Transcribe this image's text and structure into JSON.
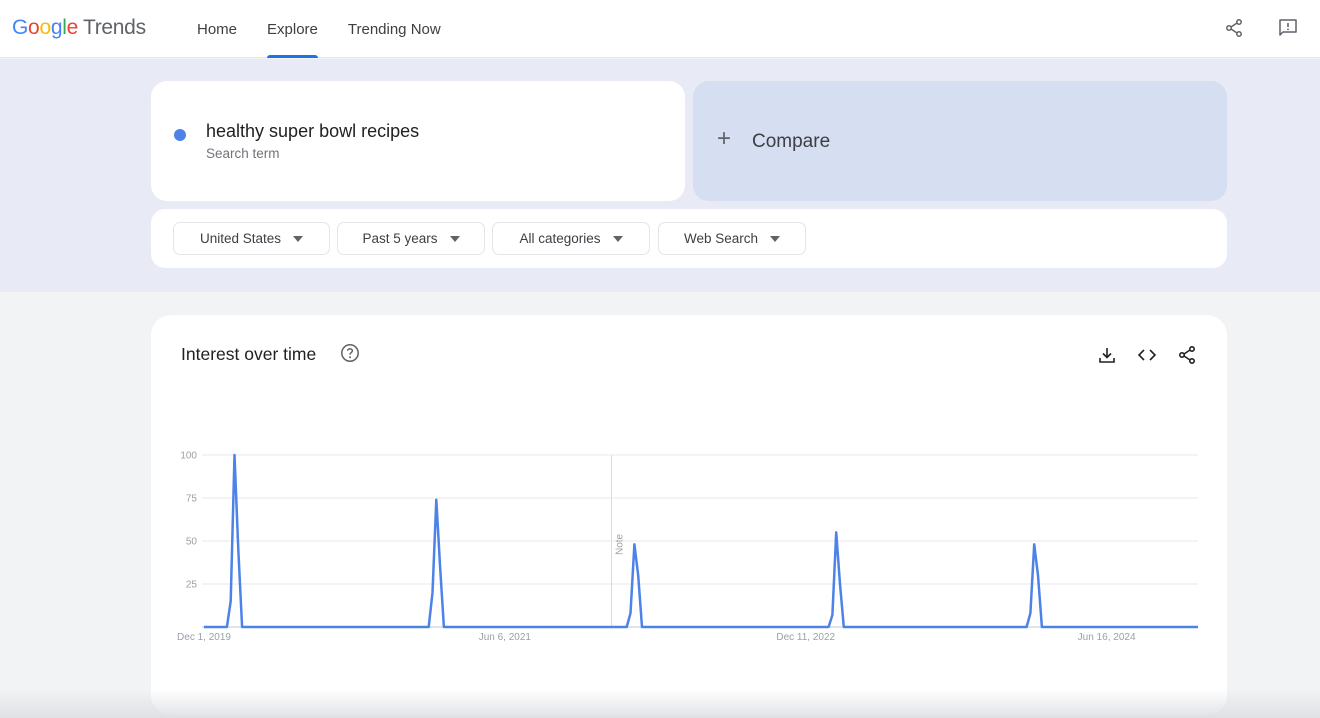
{
  "header": {
    "logo": {
      "letters": [
        "G",
        "o",
        "o",
        "g",
        "l",
        "e"
      ],
      "product": "Trends"
    },
    "nav": [
      {
        "label": "Home",
        "active": false
      },
      {
        "label": "Explore",
        "active": true
      },
      {
        "label": "Trending Now",
        "active": false
      }
    ],
    "icons": [
      "share-icon",
      "feedback-icon"
    ]
  },
  "search": {
    "term": "healthy super bowl recipes",
    "term_type": "Search term",
    "term_color": "#4d83e8",
    "compare_label": "Compare",
    "compare_icon": "+"
  },
  "filters": [
    {
      "label": "United States"
    },
    {
      "label": "Past 5 years"
    },
    {
      "label": "All categories"
    },
    {
      "label": "Web Search"
    }
  ],
  "interest_card": {
    "title": "Interest over time",
    "actions": [
      "download-icon",
      "embed-icon",
      "share-icon"
    ]
  },
  "chart_data": {
    "type": "line",
    "title": "Interest over time",
    "xlabel": "",
    "ylabel": "",
    "ylim": [
      0,
      100
    ],
    "yticks": [
      25,
      50,
      75,
      100
    ],
    "x_unit": "week",
    "x_start": "Dec 1, 2019",
    "num_weeks": 262,
    "xticks": [
      {
        "week": 0,
        "label": "Dec 1, 2019"
      },
      {
        "week": 79,
        "label": "Jun 6, 2021"
      },
      {
        "week": 158,
        "label": "Dec 11, 2022"
      },
      {
        "week": 237,
        "label": "Jun 16, 2024"
      }
    ],
    "note": {
      "week": 107,
      "label": "Note"
    },
    "grid": true,
    "legend": "none",
    "series": [
      {
        "name": "healthy super bowl recipes",
        "color": "#4d83e8",
        "default_value": 0,
        "nonzero_points": [
          {
            "week": 7,
            "value": 15
          },
          {
            "week": 8,
            "value": 100
          },
          {
            "week": 9,
            "value": 45
          },
          {
            "week": 60,
            "value": 20
          },
          {
            "week": 61,
            "value": 74
          },
          {
            "week": 62,
            "value": 35
          },
          {
            "week": 112,
            "value": 8
          },
          {
            "week": 113,
            "value": 48
          },
          {
            "week": 114,
            "value": 30
          },
          {
            "week": 165,
            "value": 7
          },
          {
            "week": 166,
            "value": 55
          },
          {
            "week": 167,
            "value": 25
          },
          {
            "week": 217,
            "value": 8
          },
          {
            "week": 218,
            "value": 48
          },
          {
            "week": 219,
            "value": 30
          }
        ]
      }
    ]
  }
}
